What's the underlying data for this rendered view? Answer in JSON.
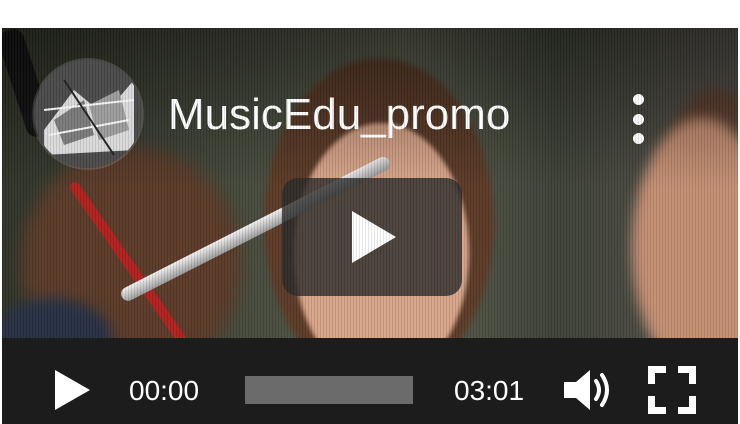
{
  "video": {
    "title": "MusicEdu_promo"
  },
  "controls": {
    "current_time": "00:00",
    "total_time": "03:01",
    "progress_fraction": 0
  },
  "colors": {
    "control_bar": "#1c1c1c",
    "progress_track": "#6b6b6b",
    "text": "#ffffff"
  },
  "icons": {
    "avatar": "channel-avatar",
    "more": "more-vertical-icon",
    "big_play": "play-icon",
    "play": "play-icon",
    "volume": "volume-icon",
    "fullscreen": "fullscreen-icon"
  }
}
